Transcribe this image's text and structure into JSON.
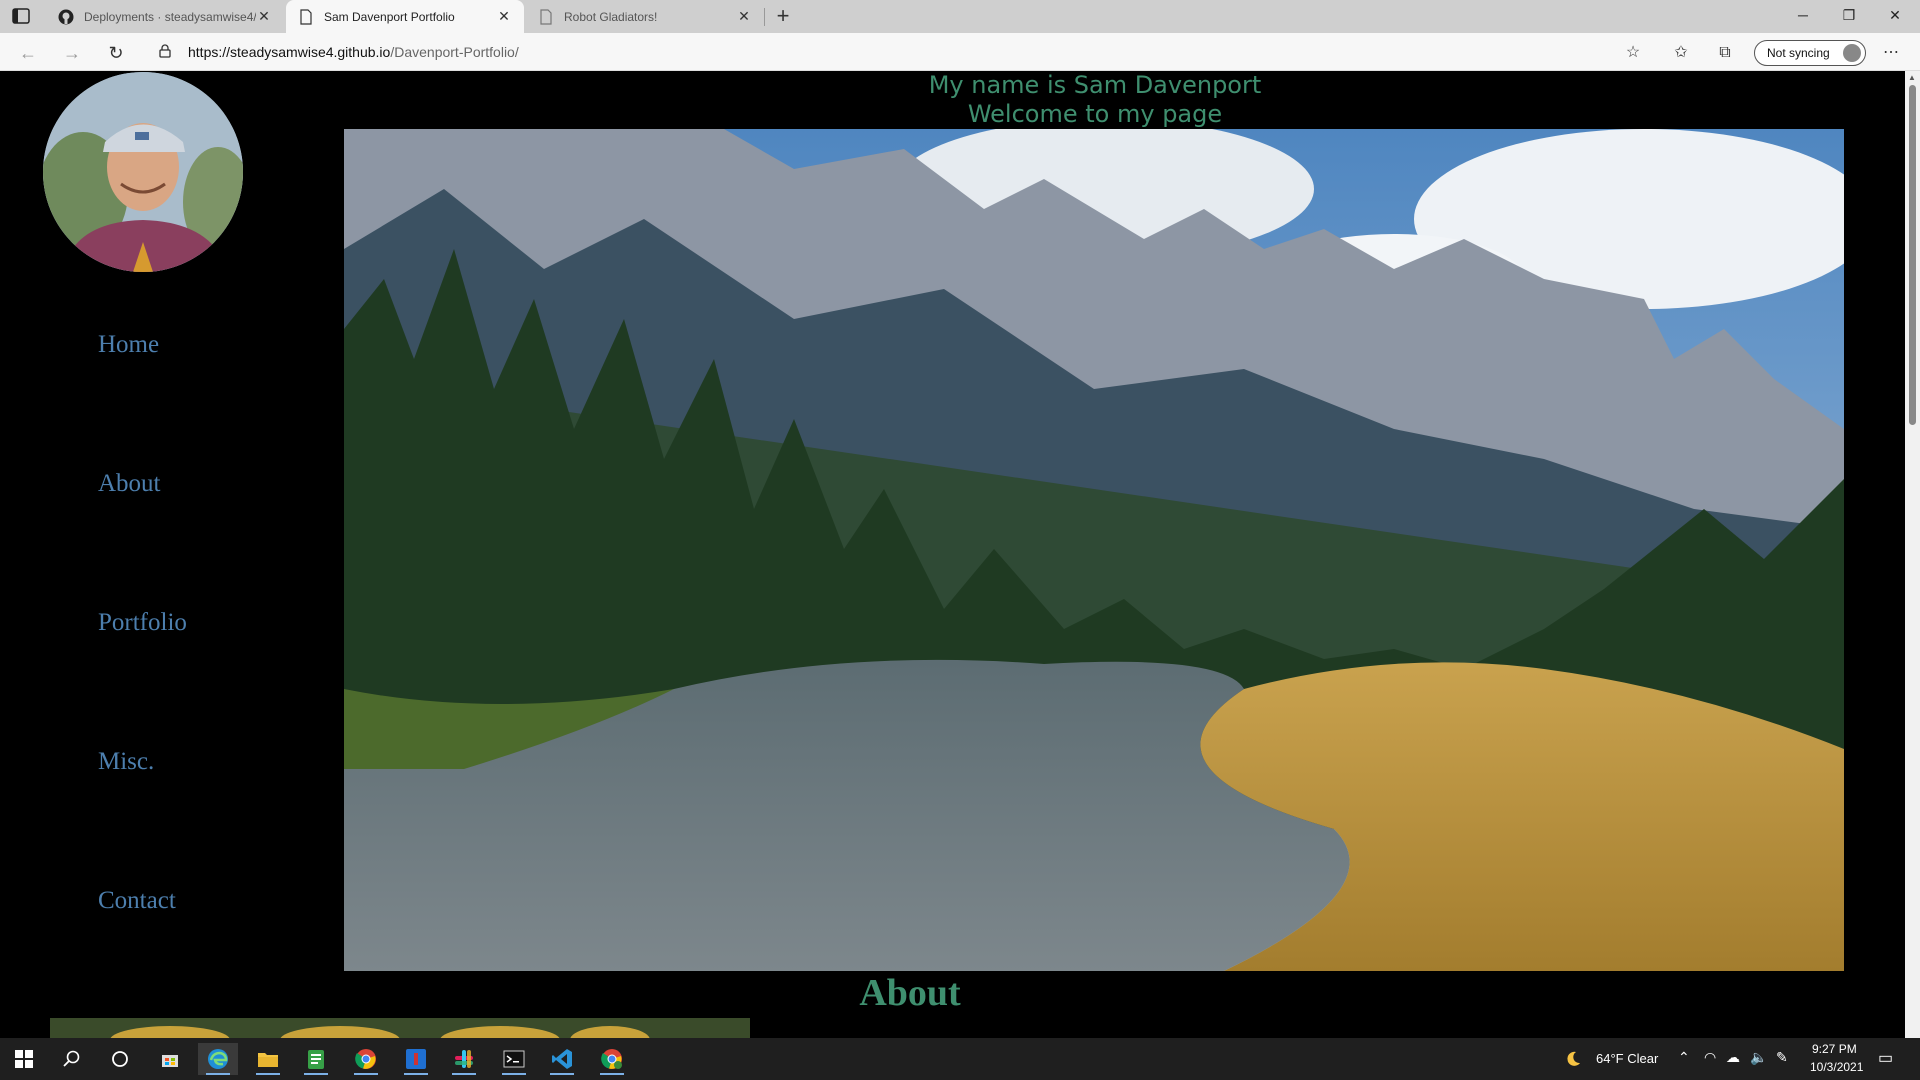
{
  "browser": {
    "tabs": [
      {
        "title": "Deployments · steadysamwise4/",
        "active": false,
        "icon": "github-icon"
      },
      {
        "title": "Sam Davenport Portfolio",
        "active": true,
        "icon": "page-icon"
      },
      {
        "title": "Robot Gladiators!",
        "active": false,
        "icon": "page-icon"
      }
    ],
    "url_host": "https://steadysamwise4.github.io",
    "url_path": "/Davenport-Portfolio/",
    "sync_label": "Not syncing"
  },
  "page": {
    "header_line1": "My name is Sam Davenport",
    "header_line2": "Welcome to my page",
    "nav": [
      {
        "label": "Home"
      },
      {
        "label": "About"
      },
      {
        "label": "Portfolio"
      },
      {
        "label": "Misc."
      },
      {
        "label": "Contact"
      }
    ],
    "about_heading": "About"
  },
  "taskbar": {
    "apps": [
      "windows-start-icon",
      "search-icon",
      "cortana-icon",
      "store-icon",
      "edge-icon",
      "file-explorer-icon",
      "notepad-icon",
      "chrome-icon",
      "onenote-icon",
      "slack-icon",
      "terminal-icon",
      "vscode-icon",
      "chrome-profile-icon"
    ],
    "weather": "64°F  Clear",
    "time": "9:27 PM",
    "date": "10/3/2021"
  },
  "colors": {
    "header_text": "#3f8f6f",
    "nav_link": "#4d7fae",
    "page_bg": "#000000"
  }
}
